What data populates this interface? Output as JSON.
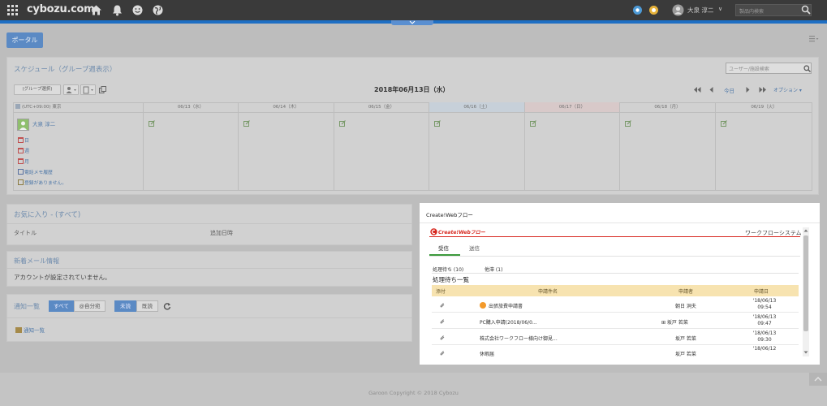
{
  "topbar": {
    "logo": "cybozu.com",
    "user_name": "大泉 淳二",
    "user_caret": "∨",
    "search_placeholder": "製品内検索"
  },
  "portal": {
    "button_label": "ポータル"
  },
  "schedule": {
    "title": "スケジュール（グループ週表示）",
    "user_search_placeholder": "ユーザー/施設検索",
    "group_select": "(グループ選択)",
    "date_title": "2018年06月13日（水）",
    "nav": {
      "today": "今日",
      "option": "オプション ▾"
    },
    "timezone": "(UTC+09:00) 東京",
    "days": [
      "06/13（水）",
      "06/14（木）",
      "06/15（金）",
      "06/16（土）",
      "06/17（日）",
      "06/18（月）",
      "06/19（火）"
    ],
    "user": {
      "name": "大泉 淳二",
      "links": [
        "日",
        "週",
        "月",
        "電話メモ履歴"
      ],
      "presence": "登録がありません。"
    }
  },
  "favorites": {
    "title": "お気に入り - (すべて)",
    "col_title": "タイトル",
    "col_added": "追加日時"
  },
  "mail": {
    "title": "新着メール情報",
    "message": "アカウントが設定されていません。"
  },
  "notify": {
    "title": "通知一覧",
    "filter_all": "すべて",
    "filter_me": "@自分宛",
    "filter_unread": "未読",
    "filter_read": "既読",
    "link": "通知一覧"
  },
  "workflow": {
    "panel_title": "Create!Webフロー",
    "brand": "Create!Webフロー",
    "system_label": "ワークフローシステム",
    "tabs": [
      "受信",
      "送信"
    ],
    "subtabs": [
      "処理待ち (10)",
      "他滞 (1)"
    ],
    "list_title": "処理待ち一覧",
    "columns": [
      "添付",
      "申請件名",
      "申請者",
      "申請日"
    ],
    "rows": [
      {
        "subject": "出張旅費申請書",
        "applicant": "朝日 洞夫",
        "date": "'18/06/13",
        "time": "09:54"
      },
      {
        "subject": "PC購入申請(2018/06/0...",
        "applicant": "⊞ 坂戸 若菜",
        "date": "'18/06/13",
        "time": "09:47"
      },
      {
        "subject": "株式会社ワークフロー様向け御見...",
        "applicant": "坂戸 若菜",
        "date": "'18/06/13",
        "time": "09:30"
      },
      {
        "subject": "休暇届",
        "applicant": "坂戸 若菜",
        "date": "'18/06/12",
        "time": ""
      }
    ]
  },
  "footer": {
    "copyright": "Garoon Copyright © 2018 Cybozu"
  }
}
